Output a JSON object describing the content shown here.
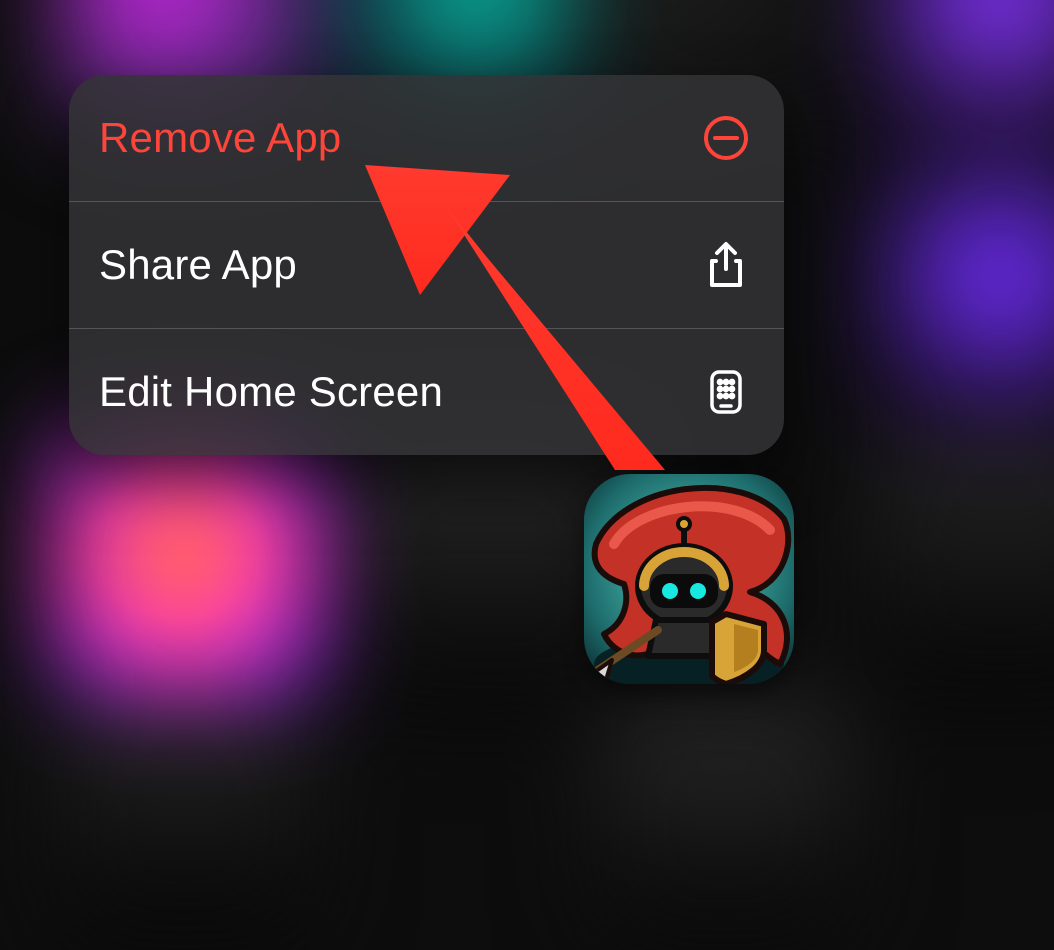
{
  "menu": {
    "items": [
      {
        "label": "Remove App",
        "icon": "minus-circle-icon",
        "destructive": true
      },
      {
        "label": "Share App",
        "icon": "share-icon",
        "destructive": false
      },
      {
        "label": "Edit Home Screen",
        "icon": "apps-grid-icon",
        "destructive": false
      }
    ]
  },
  "colors": {
    "destructive": "#fe453a",
    "text": "#ffffff",
    "card": "#343436"
  },
  "callout": {
    "target": "remove-app-menu-item",
    "color": "#ff3024"
  },
  "app": {
    "name": "game-app-icon"
  }
}
